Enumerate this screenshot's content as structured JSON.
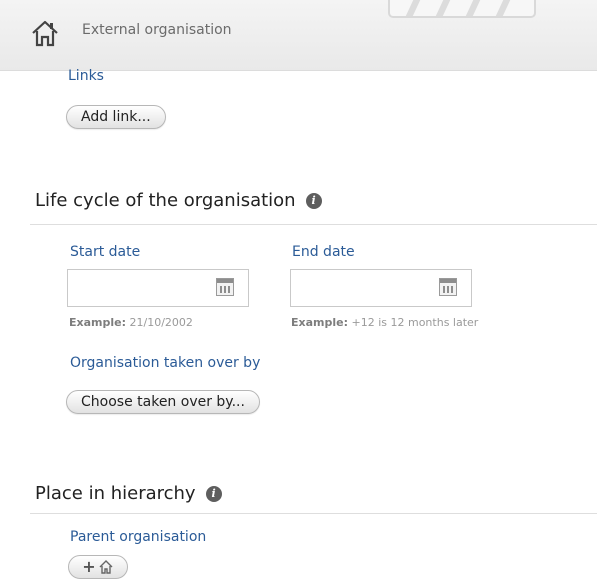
{
  "header": {
    "title": "External organisation"
  },
  "links": {
    "label": "Links",
    "add_button": "Add link..."
  },
  "life_cycle": {
    "title": "Life cycle of the organisation",
    "start_date": {
      "label": "Start date",
      "value": "",
      "example_prefix": "Example:",
      "example_text": "21/10/2002"
    },
    "end_date": {
      "label": "End date",
      "value": "",
      "example_prefix": "Example:",
      "example_text": "+12 is 12 months later"
    },
    "taken_over": {
      "label": "Organisation taken over by",
      "button": "Choose taken over by..."
    }
  },
  "hierarchy": {
    "title": "Place in hierarchy",
    "parent_label": "Parent organisation",
    "parent_button_icon": "plus-home-icon"
  }
}
